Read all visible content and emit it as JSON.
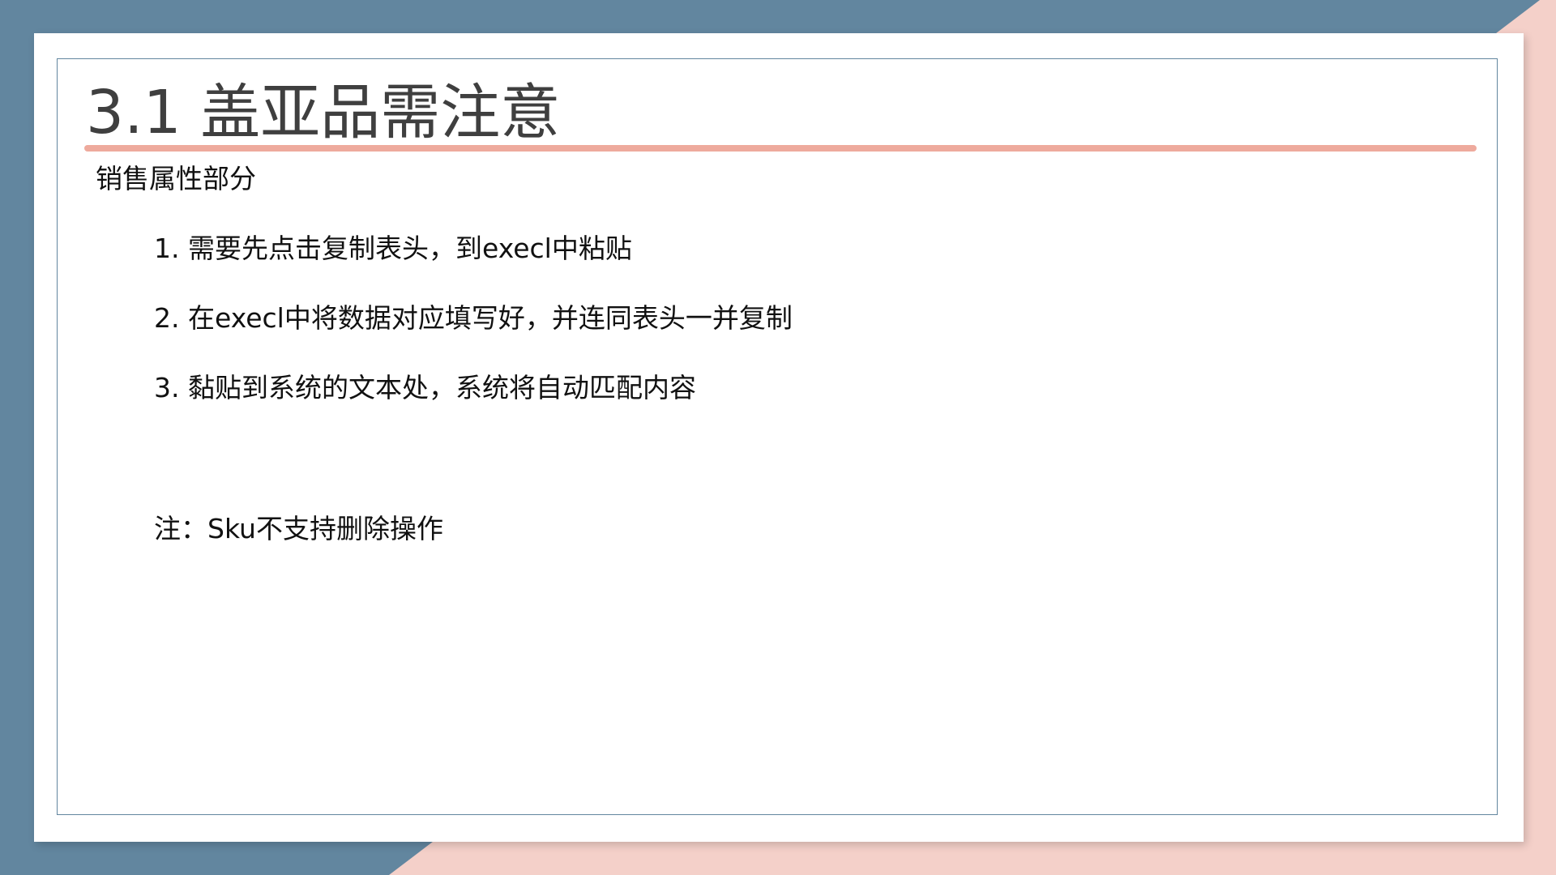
{
  "colors": {
    "background_blue": "#62869f",
    "background_pink": "#f4d0c9",
    "card": "#ffffff",
    "frame_border": "#62869f",
    "title_rule": "#eeaa9d",
    "title_text": "#3f3f3f",
    "body_text": "#111111"
  },
  "slide": {
    "title": "3.1 盖亚品需注意",
    "section_label": "销售属性部分",
    "steps": [
      "1. 需要先点击复制表头，到execl中粘贴",
      "2. 在execl中将数据对应填写好，并连同表头一并复制",
      "3. 黏贴到系统的文本处，系统将自动匹配内容"
    ],
    "note": "注：Sku不支持删除操作"
  }
}
